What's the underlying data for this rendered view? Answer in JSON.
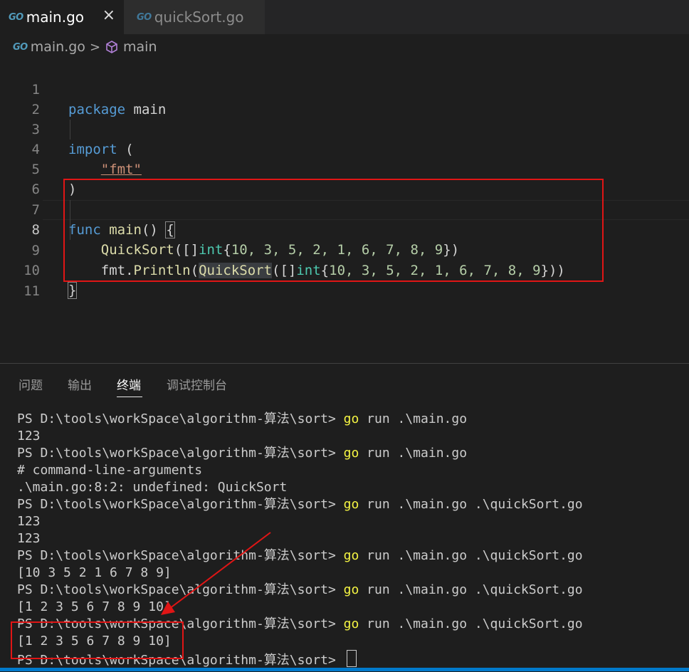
{
  "tabs": [
    {
      "icon": "go-file-icon",
      "icon_text": "GO",
      "label": "main.go",
      "active": true,
      "close": "×"
    },
    {
      "icon": "go-file-icon",
      "icon_text": "GO",
      "label": "quickSort.go",
      "active": false
    }
  ],
  "breadcrumb": {
    "file_icon_text": "GO",
    "file": "main.go",
    "separator": ">",
    "symbol": "main",
    "symbol_icon": "cube-icon"
  },
  "editor": {
    "current_line": 8,
    "line_numbers": [
      "1",
      "2",
      "3",
      "4",
      "5",
      "6",
      "7",
      "8",
      "9",
      "10",
      "11"
    ],
    "code": {
      "l1_kw": "package",
      "l1_name": " main",
      "l3_kw": "import",
      "l3_rest": " (",
      "l4_indent": "    ",
      "l4_str": "\"fmt\"",
      "l5": ")",
      "l7_kw": "func",
      "l7_sp": " ",
      "l7_fn": "main",
      "l7_paren": "() ",
      "l7_brace": "{",
      "l8_indent": "    ",
      "l8_fn": "QuickSort",
      "l8_a": "([]",
      "l8_ty": "int",
      "l8_b": "{",
      "l8_nums": "10, 3, 5, 2, 1, 6, 7, 8, 9",
      "l8_c": "})",
      "l9_indent": "    ",
      "l9_pkg": "fmt.",
      "l9_fn": "Println",
      "l9_a": "(",
      "l9_fn2": "QuickSort",
      "l9_b": "([]",
      "l9_ty": "int",
      "l9_c": "{",
      "l9_nums": "10, 3, 5, 2, 1, 6, 7, 8, 9",
      "l9_d": "}))",
      "l10": "}"
    }
  },
  "panel": {
    "tabs": [
      "问题",
      "输出",
      "终端",
      "调试控制台"
    ],
    "active_tab": "终端"
  },
  "terminal": {
    "prompt": "PS D:\\tools\\workSpace\\algorithm-算法\\sort> ",
    "go": "go",
    "lines": [
      {
        "type": "cmd",
        "args": " run .\\main.go"
      },
      {
        "type": "out",
        "text": "123"
      },
      {
        "type": "cmd",
        "args": " run .\\main.go"
      },
      {
        "type": "out",
        "text": "# command-line-arguments"
      },
      {
        "type": "out",
        "text": ".\\main.go:8:2: undefined: QuickSort"
      },
      {
        "type": "cmd",
        "args": " run .\\main.go .\\quickSort.go"
      },
      {
        "type": "out",
        "text": "123"
      },
      {
        "type": "out",
        "text": "123"
      },
      {
        "type": "cmd",
        "args": " run .\\main.go .\\quickSort.go"
      },
      {
        "type": "out",
        "text": "[10 3 5 2 1 6 7 8 9]"
      },
      {
        "type": "cmd",
        "args": " run .\\main.go .\\quickSort.go"
      },
      {
        "type": "out",
        "text": "[1 2 3 5 6 7 8 9 10]"
      },
      {
        "type": "cmd",
        "args": " run .\\main.go .\\quickSort.go"
      },
      {
        "type": "out",
        "text": "[1 2 3 5 6 7 8 9 10]"
      },
      {
        "type": "prompt"
      }
    ]
  },
  "colors": {
    "annotation_red": "#e01515",
    "keyword": "#569cd6",
    "function": "#dcdcaa",
    "type": "#4ec9b0",
    "number": "#b5cea8",
    "string": "#ce9178",
    "terminal_go": "#f5f543",
    "status_bar": "#007acc"
  }
}
